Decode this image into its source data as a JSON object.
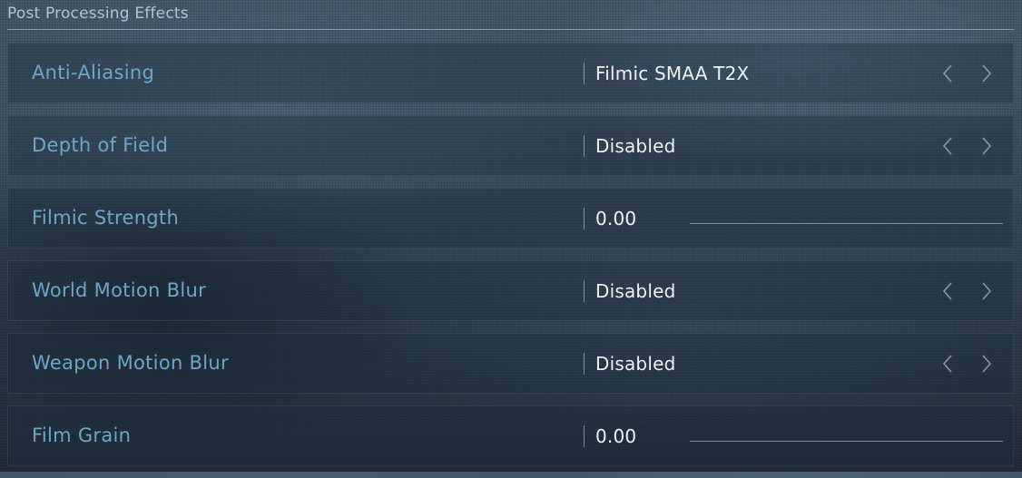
{
  "section": {
    "title": "Post Processing Effects"
  },
  "settings": [
    {
      "label": "Anti-Aliasing",
      "value": "Filmic SMAA T2X",
      "control": "selector"
    },
    {
      "label": "Depth of Field",
      "value": "Disabled",
      "control": "selector"
    },
    {
      "label": "Filmic Strength",
      "value": "0.00",
      "control": "slider",
      "slider_fraction": 0
    },
    {
      "label": "World Motion Blur",
      "value": "Disabled",
      "control": "selector"
    },
    {
      "label": "Weapon Motion Blur",
      "value": "Disabled",
      "control": "selector"
    },
    {
      "label": "Film Grain",
      "value": "0.00",
      "control": "slider",
      "slider_fraction": 0
    }
  ],
  "icons": {
    "left": "chevron-left-icon",
    "right": "chevron-right-icon"
  },
  "colors": {
    "label": "#6fa6c7",
    "value": "#eef2f5",
    "header": "#b9c3cb"
  }
}
